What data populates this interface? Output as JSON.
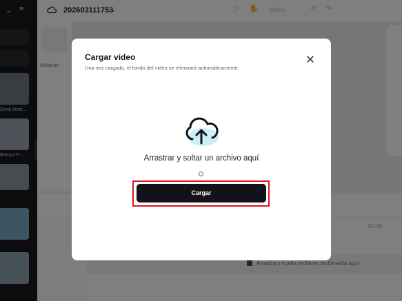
{
  "topbar": {
    "project_name": "202603111753",
    "zoom": "100%"
  },
  "left_panel": {
    "ratio_label": "Relación"
  },
  "sidebar": {
    "captions": [
      "Drink Rest...",
      "Behind P..."
    ]
  },
  "timeline": {
    "time": "00:30",
    "drop_hint": "Arrastra y suelta archivos multimedia aquí"
  },
  "modal": {
    "title": "Cargar video",
    "subtitle": "Una vez cargado, el fondo del video se eliminará automáticamente.",
    "drop_text": "Arrastrar y soltar un archivo aquí",
    "upload_button": "Cargar",
    "close_icon": "close-icon",
    "upload_icon": "cloud-upload-icon"
  },
  "colors": {
    "overlay": "rgba(0,0,0,0.5)",
    "button_bg": "#121318",
    "highlight": "#e2141b"
  }
}
